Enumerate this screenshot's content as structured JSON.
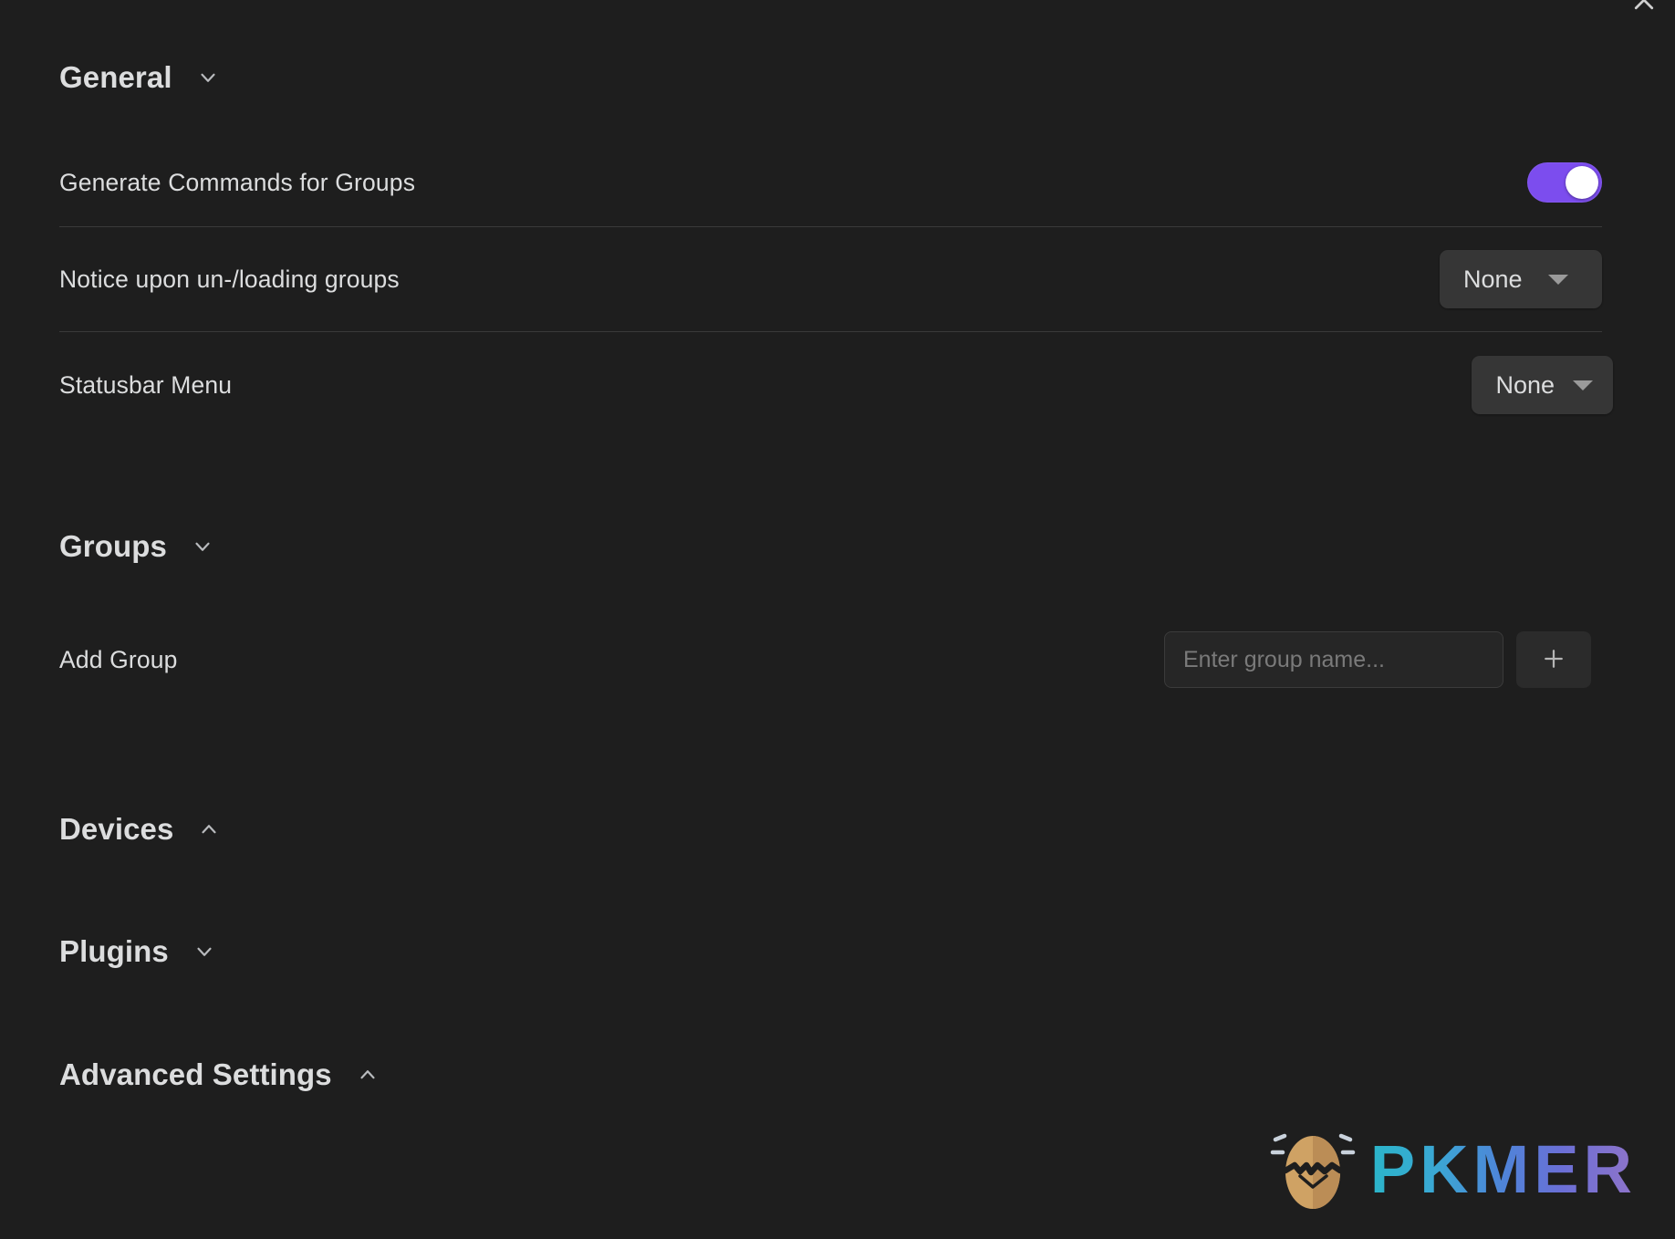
{
  "window": {
    "close_label": "×"
  },
  "sections": {
    "general": {
      "title": "General",
      "chevron": "chevron-down",
      "rows": {
        "generate_commands": {
          "label": "Generate Commands for Groups",
          "control": "toggle",
          "value": "on"
        },
        "notice_loading": {
          "label": "Notice upon un-/loading groups",
          "control": "dropdown",
          "value": "None"
        },
        "statusbar_menu": {
          "label": "Statusbar Menu",
          "control": "dropdown",
          "value": "None"
        }
      }
    },
    "groups": {
      "title": "Groups",
      "chevron": "chevron-down",
      "rows": {
        "add_group": {
          "label": "Add Group",
          "input_value": "",
          "input_placeholder": "Enter group name...",
          "add_button_label": "+"
        }
      }
    },
    "devices": {
      "title": "Devices",
      "chevron": "chevron-up"
    },
    "plugins": {
      "title": "Plugins",
      "chevron": "chevron-down"
    },
    "advanced": {
      "title": "Advanced Settings",
      "chevron": "chevron-up"
    }
  },
  "watermark": {
    "text": "PKMER",
    "icon": "cracked-egg-icon"
  },
  "colors": {
    "background": "#1e1e1e",
    "toggle_on": "#7c4dee",
    "text_primary": "#dcddde",
    "divider": "#3a3a3a",
    "control_bg": "#363636"
  }
}
